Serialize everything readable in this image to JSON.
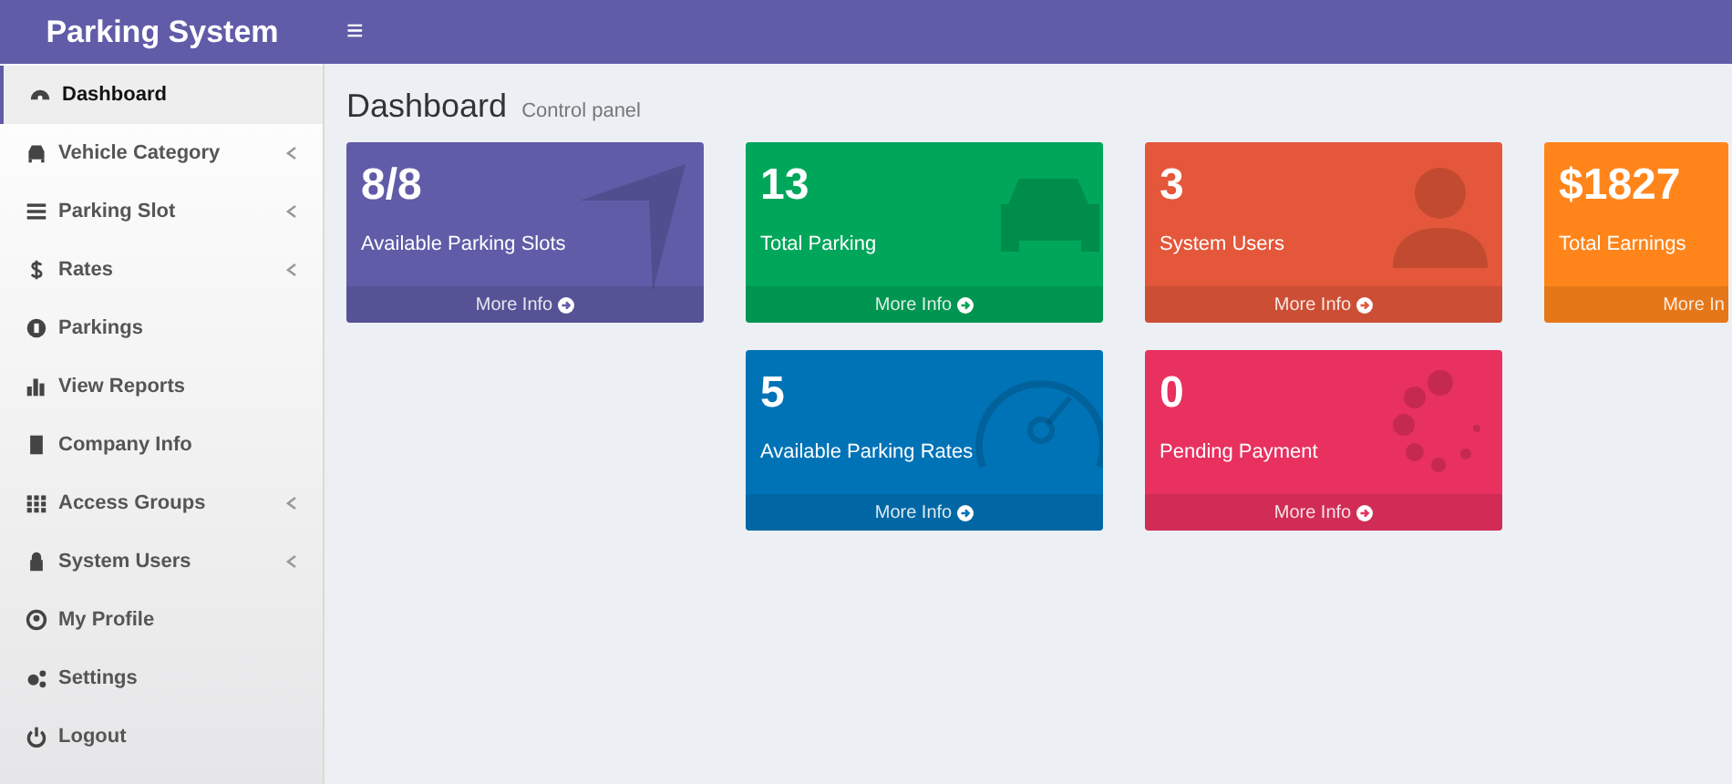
{
  "header": {
    "brand": "Parking System",
    "menu_toggle": "≡"
  },
  "sidebar": {
    "items": [
      {
        "label": "Dashboard",
        "selected": true,
        "submenu": false
      },
      {
        "label": "Vehicle Category",
        "selected": false,
        "submenu": true
      },
      {
        "label": "Parking Slot",
        "selected": false,
        "submenu": true
      },
      {
        "label": "Rates",
        "selected": false,
        "submenu": true
      },
      {
        "label": "Parkings",
        "selected": false,
        "submenu": false
      },
      {
        "label": "View Reports",
        "selected": false,
        "submenu": false
      },
      {
        "label": "Company Info",
        "selected": false,
        "submenu": false
      },
      {
        "label": "Access Groups",
        "selected": false,
        "submenu": true
      },
      {
        "label": "System Users",
        "selected": false,
        "submenu": true
      },
      {
        "label": "My Profile",
        "selected": false,
        "submenu": false
      },
      {
        "label": "Settings",
        "selected": false,
        "submenu": false
      },
      {
        "label": "Logout",
        "selected": false,
        "submenu": false
      }
    ]
  },
  "page": {
    "title": "Dashboard",
    "subtitle": "Control panel"
  },
  "rows": [
    [
      {
        "value": "8/8",
        "label": "Available Parking Slots",
        "link": "More Info",
        "color": "#605ca8"
      },
      {
        "value": "13",
        "label": "Total Parking",
        "link": "More Info",
        "color": "#00a65a"
      },
      {
        "value": "3",
        "label": "System Users",
        "link": "More Info",
        "color": "#e4573a"
      },
      {
        "value": "$1827",
        "label": "Total Earnings",
        "link": "More In",
        "color": "#ff851b"
      }
    ],
    [
      {
        "value": "5",
        "label": "Available Parking Rates",
        "link": "More Info",
        "color": "#0073b7"
      },
      {
        "value": "0",
        "label": "Pending Payment",
        "link": "More Info",
        "color": "#e8315f"
      }
    ]
  ]
}
